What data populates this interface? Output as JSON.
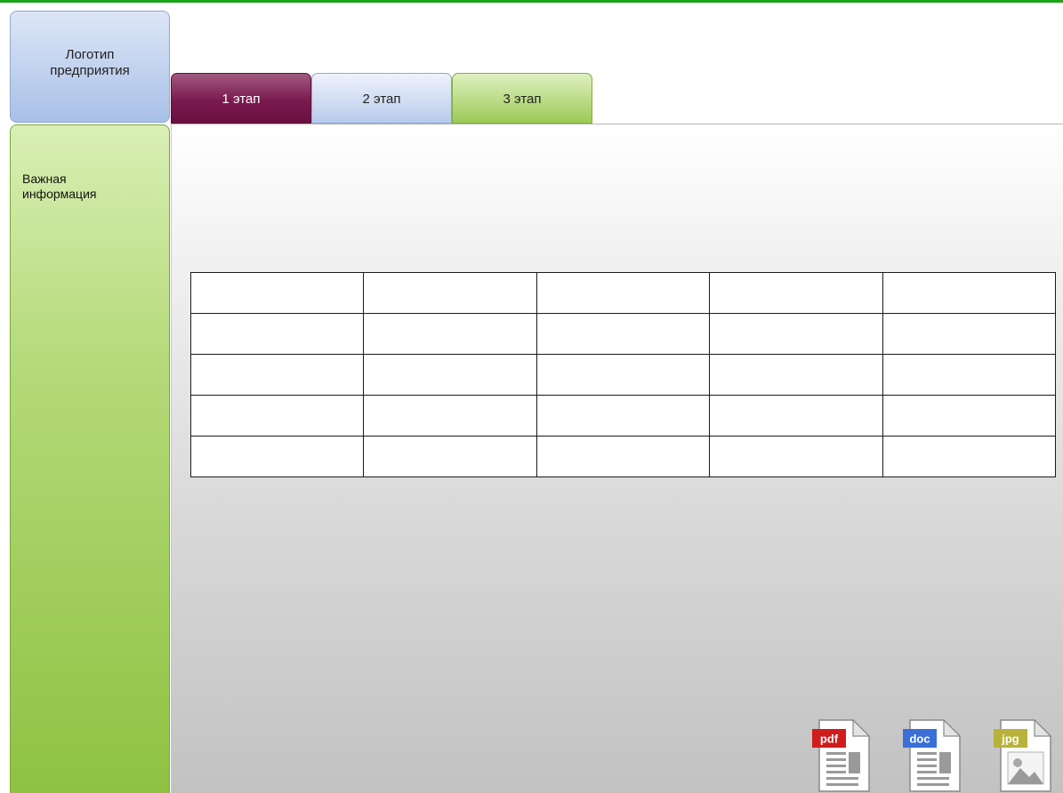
{
  "logo": {
    "label": "Логотип\nпредприятия"
  },
  "tabs": [
    {
      "label": "1 этап",
      "color": "#7a1a4f"
    },
    {
      "label": "2 этап",
      "color": "#b9cbeb"
    },
    {
      "label": "3 этап",
      "color": "#9cca56"
    }
  ],
  "sidebar": {
    "info": "Важная\nинформация"
  },
  "table": {
    "rows": [
      [
        "",
        "",
        "",
        "",
        ""
      ],
      [
        "",
        "",
        "",
        "",
        ""
      ],
      [
        "",
        "",
        "",
        "",
        ""
      ],
      [
        "",
        "",
        "",
        "",
        ""
      ],
      [
        "",
        "",
        "",
        "",
        ""
      ]
    ]
  },
  "files": [
    {
      "icon": "pdf-file-icon",
      "label": "pdf",
      "color": "#cc1a1a"
    },
    {
      "icon": "doc-file-icon",
      "label": "doc",
      "color": "#3a6fd8"
    },
    {
      "icon": "jpg-file-icon",
      "label": "jpg",
      "color": "#b8b23a"
    }
  ]
}
